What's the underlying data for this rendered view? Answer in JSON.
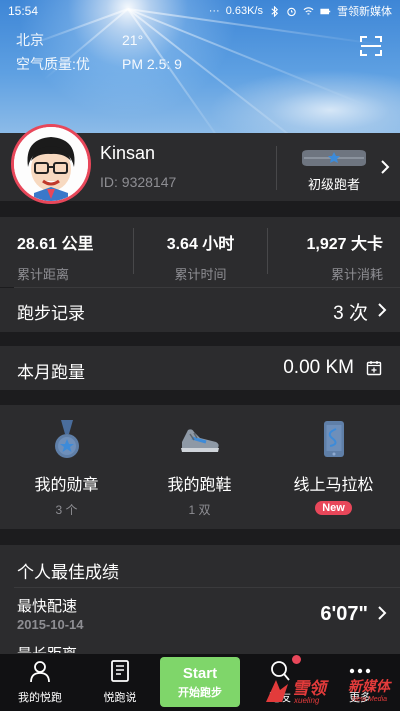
{
  "status_bar": {
    "time": "15:54",
    "network_speed": "0.63K/s",
    "carrier_text": "雪领新媒体"
  },
  "weather": {
    "city": "北京",
    "temperature": "21°",
    "air_quality": "空气质量:优",
    "pm25": "PM 2.5: 9"
  },
  "profile": {
    "name": "Kinsan",
    "id": "ID: 9328147",
    "rank_label": "初级跑者"
  },
  "stats": [
    {
      "value": "28.61 公里",
      "label": "累计距离"
    },
    {
      "value": "3.64 小时",
      "label": "累计时间"
    },
    {
      "value": "1,927 大卡",
      "label": "累计消耗"
    }
  ],
  "run_record": {
    "label": "跑步记录",
    "value": "3 次"
  },
  "monthly": {
    "label": "本月跑量",
    "value": "0.00 KM"
  },
  "grid": [
    {
      "label": "我的勋章",
      "sub": "3 个",
      "icon": "medal-icon"
    },
    {
      "label": "我的跑鞋",
      "sub": "1 双",
      "icon": "shoe-icon"
    },
    {
      "label": "线上马拉松",
      "badge": "New",
      "icon": "phone-route-icon"
    }
  ],
  "best": {
    "title": "个人最佳成绩",
    "fastest_label": "最快配速",
    "fastest_date": "2015-10-14",
    "fastest_value": "6'07\"",
    "longest_label": "最长距离"
  },
  "tabs": [
    {
      "label": "我的悦跑",
      "icon": "person-icon"
    },
    {
      "label": "悦跑说",
      "icon": "book-icon"
    },
    {
      "label": "跑友",
      "icon": "search-person-icon"
    },
    {
      "label": "更多",
      "icon": "more-dots-icon"
    }
  ],
  "start_button": {
    "title": "Start",
    "subtitle": "开始跑步"
  },
  "watermark": {
    "brand": "雪领",
    "pinyin": "xueling",
    "media": "新媒体",
    "media_en": "New Media"
  },
  "colors": {
    "accent": "#7fd66a",
    "red": "#e8475a",
    "panel": "#2c2c2e",
    "background": "#1c1c1e"
  }
}
